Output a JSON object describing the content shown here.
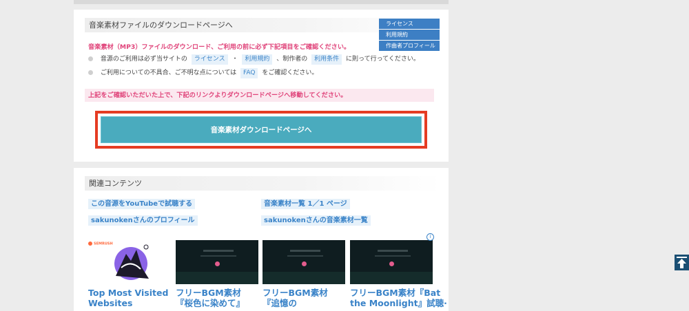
{
  "download_section": {
    "heading": "音楽素材ファイルのダウンロードページへ",
    "side_buttons": [
      "ライセンス",
      "利用規約",
      "作曲者プロフィール"
    ],
    "notice": "音楽素材（MP3）ファイルのダウンロード、ご利用の前に必ず下記項目をご確認ください。",
    "bullet1": {
      "prefix": "音源のご利用は必ず当サイトの",
      "link1": "ライセンス",
      "sep": "・",
      "link2": "利用規約",
      "middle": "、制作者の",
      "link3": "利用条件",
      "suffix": "に則って行ってください。"
    },
    "bullet2": {
      "prefix": "ご利用についての不具合、ご不明な点については",
      "link": "FAQ",
      "suffix": "をご確認ください。"
    },
    "confirm_notice": "上記をご確認いただいた上で、下記のリンクよりダウンロードページへ移動してください。",
    "download_button": "音楽素材ダウンロードページへ"
  },
  "related_section": {
    "heading": "関連コンテンツ",
    "links": [
      "この音源をYouTubeで試聴する",
      "音楽素材一覧 1／1 ページ",
      "sakunokenさんのプロフィール",
      "sakunokenさんの音楽素材一覧"
    ],
    "ads": [
      {
        "brand": "SEMRUSH",
        "title_lines": [
          "Top Most Visited",
          "Websites"
        ]
      },
      {
        "title_lines": [
          "フリーBGM素材",
          "『桜色に染めて』"
        ]
      },
      {
        "title_lines": [
          "フリーBGM素材",
          "『追憶の"
        ]
      },
      {
        "title_lines": [
          "フリーBGM素材『Bat",
          "the Moonlight』試聴·"
        ]
      }
    ],
    "adchoice_icon": "info-icon"
  },
  "page_top_icon": "arrow-up-icon"
}
